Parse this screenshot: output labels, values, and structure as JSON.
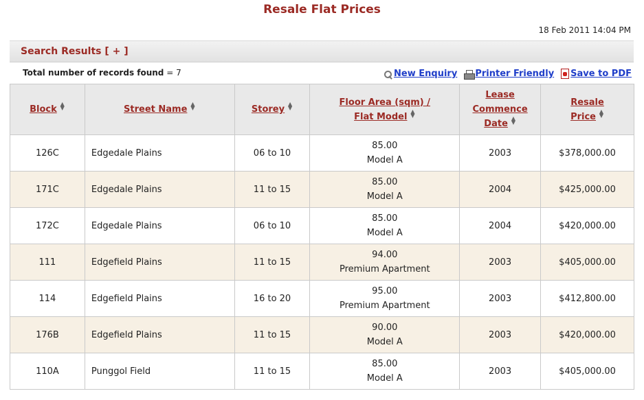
{
  "page": {
    "title": "Resale Flat Prices",
    "timestamp": "18 Feb 2011 14:04 PM"
  },
  "results": {
    "title": "Search Results",
    "toggle": "[ + ]",
    "records_label": "Total number of records found",
    "records_eq": " = ",
    "records_count": "7"
  },
  "actions": {
    "new_enquiry": "New Enquiry",
    "printer_friendly": "Printer Friendly",
    "save_pdf": "Save to PDF",
    "icons": [
      "magnifier-icon",
      "printer-icon",
      "pdf-icon"
    ]
  },
  "table": {
    "headers": {
      "block": "Block",
      "street": "Street Name",
      "storey": "Storey",
      "floor_area_1": "Floor Area (sqm) /",
      "floor_area_2": "Flat Model",
      "lease_1": "Lease",
      "lease_2": "Commence",
      "lease_3": "Date",
      "price_1": "Resale",
      "price_2": "Price"
    },
    "rows": [
      {
        "block": "126C",
        "street": "Edgedale Plains",
        "storey": "06 to 10",
        "area": "85.00",
        "model": "Model A",
        "lease": "2003",
        "price": "$378,000.00"
      },
      {
        "block": "171C",
        "street": "Edgedale Plains",
        "storey": "11 to 15",
        "area": "85.00",
        "model": "Model A",
        "lease": "2004",
        "price": "$425,000.00"
      },
      {
        "block": "172C",
        "street": "Edgedale Plains",
        "storey": "06 to 10",
        "area": "85.00",
        "model": "Model A",
        "lease": "2004",
        "price": "$420,000.00"
      },
      {
        "block": "111",
        "street": "Edgefield Plains",
        "storey": "11 to 15",
        "area": "94.00",
        "model": "Premium Apartment",
        "lease": "2003",
        "price": "$405,000.00"
      },
      {
        "block": "114",
        "street": "Edgefield Plains",
        "storey": "16 to 20",
        "area": "95.00",
        "model": "Premium Apartment",
        "lease": "2003",
        "price": "$412,800.00"
      },
      {
        "block": "176B",
        "street": "Edgefield Plains",
        "storey": "11 to 15",
        "area": "90.00",
        "model": "Model A",
        "lease": "2003",
        "price": "$420,000.00"
      },
      {
        "block": "110A",
        "street": "Punggol Field",
        "storey": "11 to 15",
        "area": "85.00",
        "model": "Model A",
        "lease": "2003",
        "price": "$405,000.00"
      }
    ]
  },
  "colors": {
    "accent": "#9b2a24",
    "link": "#1f3ec9",
    "header_bg": "#e9e9e9",
    "alt_row": "#f7f0e4"
  }
}
